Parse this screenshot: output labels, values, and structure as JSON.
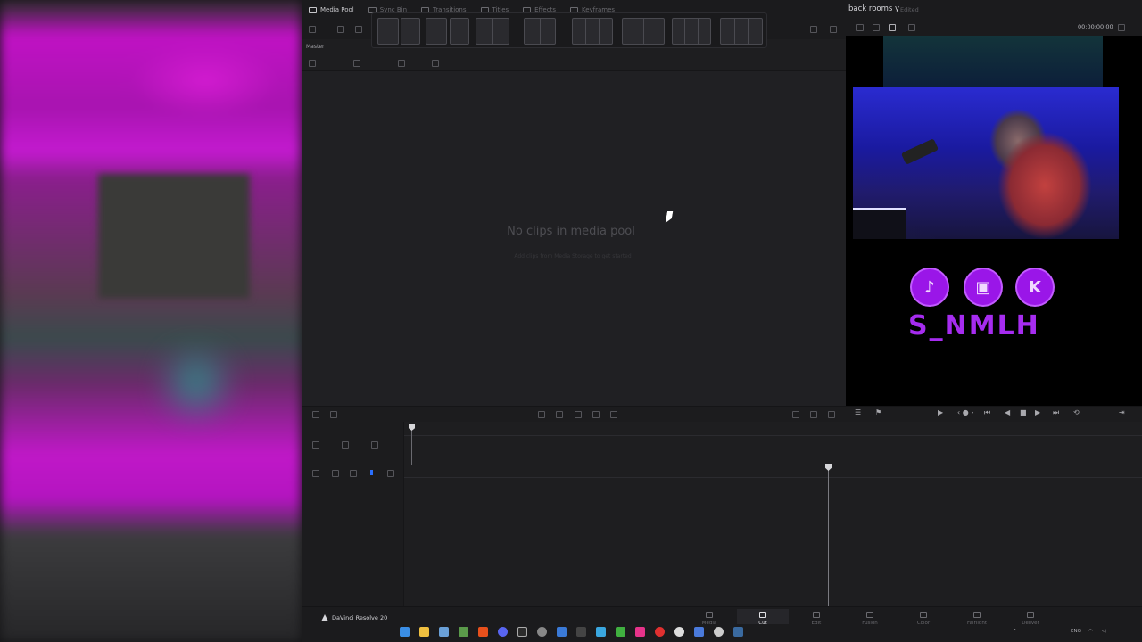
{
  "tabs": [
    {
      "label": "Media Pool",
      "active": true
    },
    {
      "label": "Sync Bin",
      "active": false
    },
    {
      "label": "Transitions",
      "active": false
    },
    {
      "label": "Titles",
      "active": false
    },
    {
      "label": "Effects",
      "active": false
    },
    {
      "label": "Keyframes",
      "active": false
    }
  ],
  "project": {
    "title": "back rooms y",
    "status": "Edited"
  },
  "viewer": {
    "timecode": "00:00:00:00"
  },
  "media_pool": {
    "bin_label": "Master",
    "empty_title": "No clips in media pool",
    "empty_subtitle": "Add clips from Media Storage to get started"
  },
  "pages": [
    {
      "label": "Media",
      "icon": "media-icon"
    },
    {
      "label": "Cut",
      "icon": "cut-icon",
      "active": true
    },
    {
      "label": "Edit",
      "icon": "edit-icon"
    },
    {
      "label": "Fusion",
      "icon": "fusion-icon"
    },
    {
      "label": "Color",
      "icon": "color-icon"
    },
    {
      "label": "Fairlight",
      "icon": "fairlight-icon"
    },
    {
      "label": "Deliver",
      "icon": "deliver-icon"
    }
  ],
  "app": {
    "name": "DaVinci Resolve 20"
  },
  "overlay": {
    "handle": "S_NMLH",
    "socials": [
      "tiktok-icon",
      "twitch-icon",
      "kick-icon"
    ],
    "accent": "#9a16e8"
  },
  "taskbar": {
    "lang": "ENG"
  },
  "colors": {
    "cut_accent": "#c71585",
    "background": "#1e1e20"
  }
}
